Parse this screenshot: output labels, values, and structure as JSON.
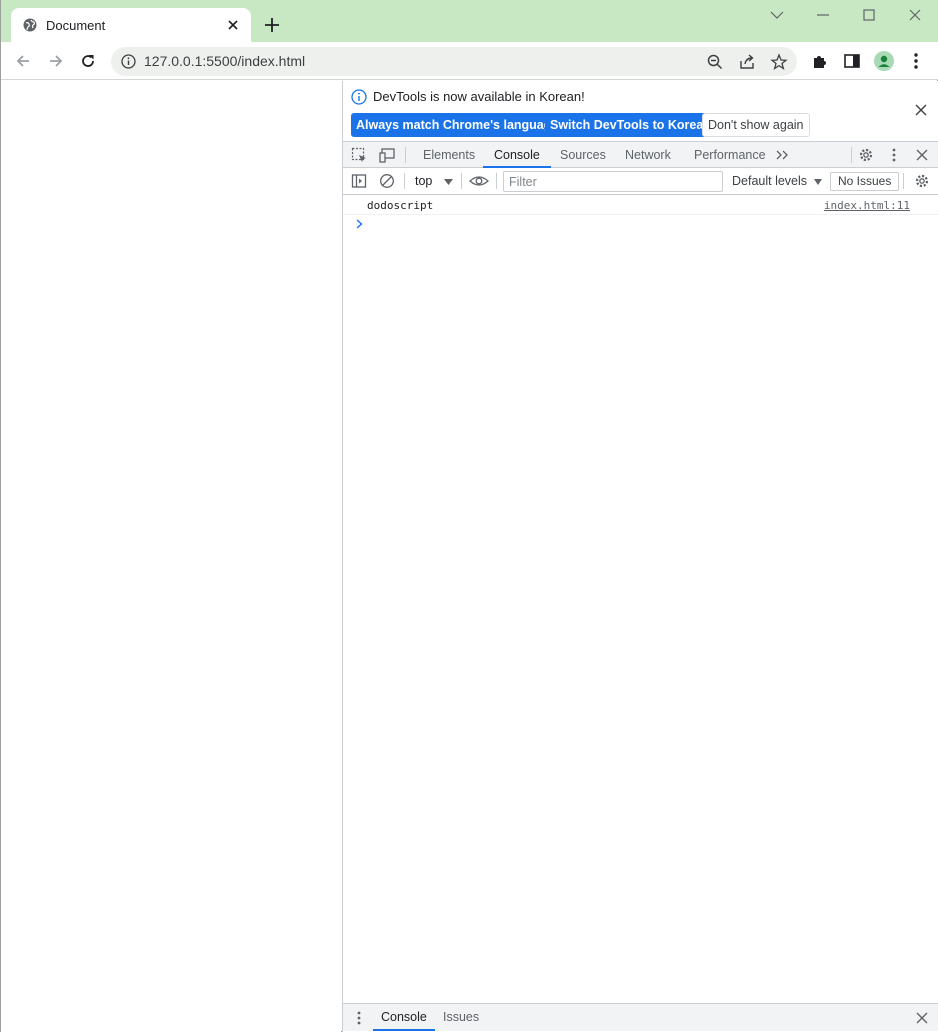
{
  "browser": {
    "tab": {
      "title": "Document",
      "favicon": "globe-icon"
    },
    "new_tab_icon": "plus-icon",
    "window_controls": [
      "chevron-down-icon",
      "minimize-icon",
      "maximize-icon",
      "close-icon"
    ],
    "address": {
      "url": "127.0.0.1:5500/index.html",
      "site_info_icon": "info-icon"
    },
    "toolbar_icons": [
      "zoom-out-icon",
      "share-icon",
      "star-icon",
      "puzzle-icon",
      "sidepanel-icon",
      "profile-icon",
      "kebab-icon"
    ],
    "accent_color": "#c7e8c2"
  },
  "devtools": {
    "infobar": {
      "message": "DevTools is now available in Korean!",
      "buttons": {
        "match": "Always match Chrome's language",
        "switch": "Switch DevTools to Korean",
        "dismiss": "Don't show again"
      }
    },
    "tabs": [
      "Elements",
      "Console",
      "Sources",
      "Network",
      "Performance"
    ],
    "active_tab": "Console",
    "console": {
      "context": "top",
      "filter_placeholder": "Filter",
      "levels": "Default levels",
      "issues": "No Issues",
      "messages": [
        {
          "text": "dodoscript",
          "source": "index.html:11"
        }
      ]
    },
    "drawer": {
      "tabs": [
        "Console",
        "Issues"
      ],
      "active_tab": "Console"
    },
    "accent_color": "#1a73e8"
  }
}
